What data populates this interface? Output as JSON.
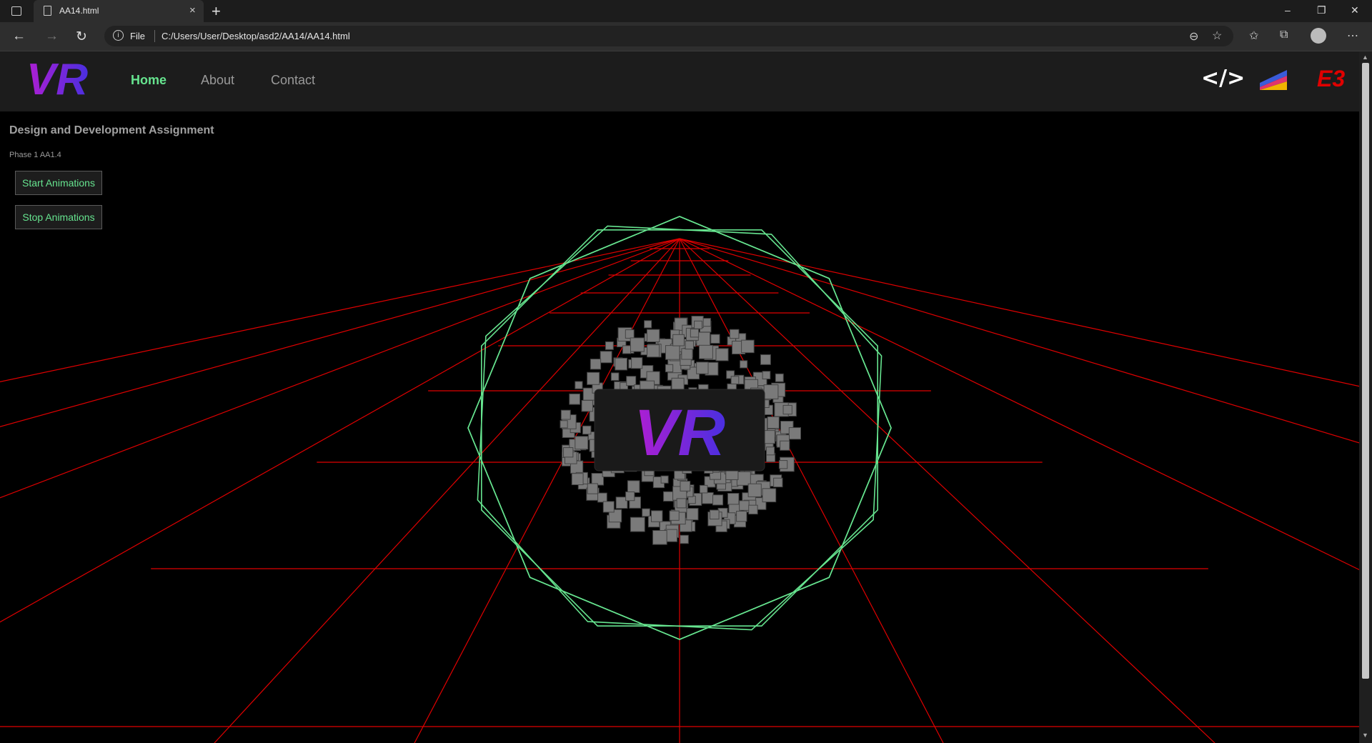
{
  "browser": {
    "tab_title": "AA14.html",
    "tab_close": "×",
    "new_tab": "+",
    "address_scheme": "File",
    "address_url": "C:/Users/User/Desktop/asd2/AA14/AA14.html",
    "window_controls": [
      "–",
      "❐",
      "✕"
    ],
    "nav_icons": [
      "←",
      "→",
      "↻"
    ],
    "toolbar_icons": [
      "⊖",
      "☆",
      "✩",
      "⧉",
      "⋯"
    ]
  },
  "site": {
    "nav_items": [
      {
        "label": "Home",
        "active": true
      },
      {
        "label": "About",
        "active": false
      },
      {
        "label": "Contact",
        "active": false
      }
    ],
    "icons": [
      "code-icon",
      "stripe-flag-icon",
      "e3-logo-icon"
    ],
    "code_icon_text": "</>",
    "e3_icon_text": "E3",
    "logo_text": "VR"
  },
  "content": {
    "title": "Design and Development Assignment",
    "subtitle": "Phase 1 AA1.4",
    "start_button": "Start Animations",
    "stop_button": "Stop Animations",
    "center_logo_text": "VR"
  },
  "colors": {
    "accent_green": "#66e48f",
    "grid_red": "#e00000",
    "logo_purple": "#9b1fd6",
    "logo_blue": "#5a2bd8",
    "e3_red": "#e00000"
  }
}
